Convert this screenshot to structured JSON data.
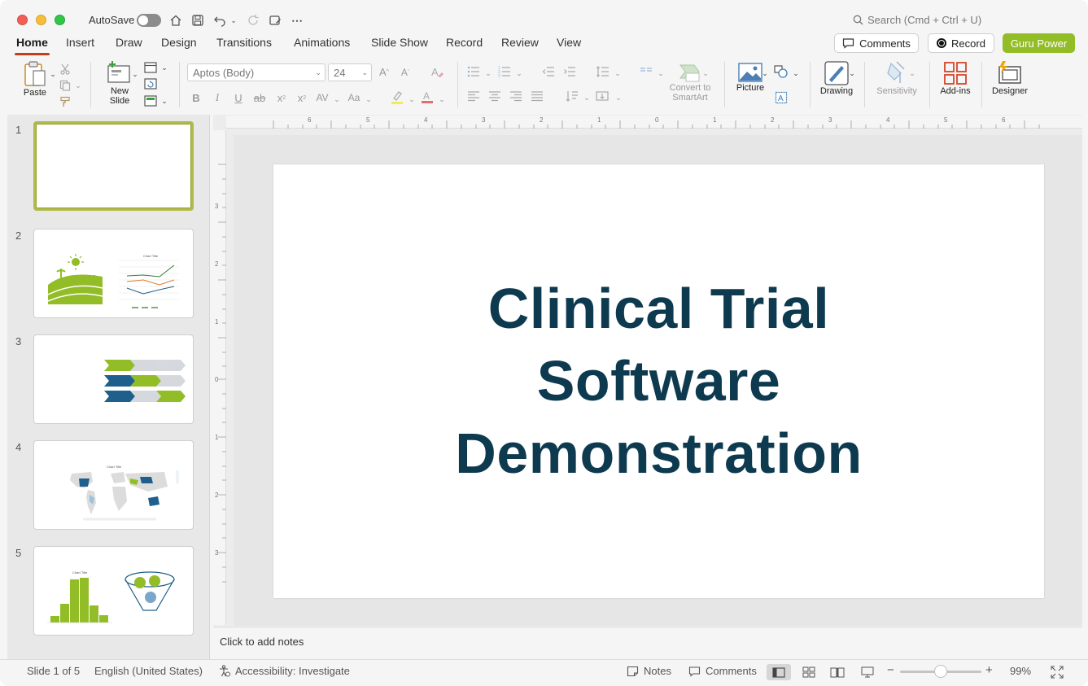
{
  "titlebar": {
    "autosave_label": "AutoSave",
    "search_placeholder": "Search (Cmd + Ctrl + U)"
  },
  "tabs": [
    {
      "label": "Home",
      "active": true
    },
    {
      "label": "Insert"
    },
    {
      "label": "Draw"
    },
    {
      "label": "Design"
    },
    {
      "label": "Transitions"
    },
    {
      "label": "Animations"
    },
    {
      "label": "Slide Show"
    },
    {
      "label": "Record"
    },
    {
      "label": "Review"
    },
    {
      "label": "View"
    }
  ],
  "top_buttons": {
    "comments": "Comments",
    "record": "Record",
    "guru": "Guru Power"
  },
  "ribbon": {
    "paste": "Paste",
    "new_slide_1": "New",
    "new_slide_2": "Slide",
    "font_name": "Aptos (Body)",
    "font_size": "24",
    "convert_1": "Convert to",
    "convert_2": "SmartArt",
    "picture": "Picture",
    "drawing": "Drawing",
    "sensitivity": "Sensitivity",
    "addins": "Add-ins",
    "designer": "Designer"
  },
  "thumbnails": [
    {
      "num": "1"
    },
    {
      "num": "2",
      "chart_title": "Chart Title"
    },
    {
      "num": "3"
    },
    {
      "num": "4",
      "chart_title": "Chart Title"
    },
    {
      "num": "5",
      "chart_title": "Chart Title"
    }
  ],
  "slide": {
    "title_line1": "Clinical Trial",
    "title_line2": "Software",
    "title_line3": "Demonstration"
  },
  "notes": {
    "placeholder": "Click to add notes"
  },
  "status": {
    "slide_info": "Slide 1 of 5",
    "language": "English (United States)",
    "accessibility": "Accessibility: Investigate",
    "notes": "Notes",
    "comments": "Comments",
    "zoom": "99%"
  },
  "colors": {
    "accent_green": "#92bd27",
    "title_navy": "#0e3a50",
    "tab_underline": "#c43e1c"
  }
}
